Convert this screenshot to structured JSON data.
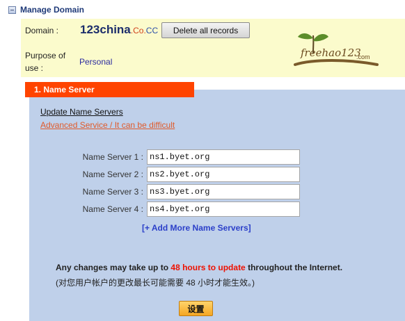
{
  "header": {
    "title": "Manage Domain",
    "icon": "collapse-icon"
  },
  "domain": {
    "label": "Domain :",
    "name": "123china",
    "tld_co": ".Co.",
    "tld_cc": "CC",
    "delete_button": "Delete all records"
  },
  "purpose": {
    "label": "Purpose of use :",
    "value": "Personal"
  },
  "logo": {
    "text": "freehao123",
    "suffix": ".com",
    "icon": "leaf-sprout-icon"
  },
  "section": {
    "tab_label": "1. Name Server"
  },
  "update": {
    "title": "Update Name Servers",
    "advanced_link": "Advanced Service / It can be difficult"
  },
  "name_servers": [
    {
      "label": "Name Server 1 :",
      "value": "ns1.byet.org"
    },
    {
      "label": "Name Server 2 :",
      "value": "ns2.byet.org"
    },
    {
      "label": "Name Server 3 :",
      "value": "ns3.byet.org"
    },
    {
      "label": "Name Server 4 :",
      "value": "ns4.byet.org"
    }
  ],
  "add_more": "[+ Add More Name Servers]",
  "notice": {
    "before": "Any changes may take up to ",
    "highlight": "48 hours to update",
    "after": " throughout the Internet.",
    "chinese": "(对您用户帐户的更改最长可能需要 48 小时才能生效。)"
  },
  "submit_button": "设置",
  "colors": {
    "header_title": "#1f3a78",
    "top_panel_bg": "#fbfbcc",
    "tab_bg": "#ff4400",
    "section_bg": "#bfd0ea",
    "highlight": "#ee1100",
    "link": "#2b3fc9"
  }
}
